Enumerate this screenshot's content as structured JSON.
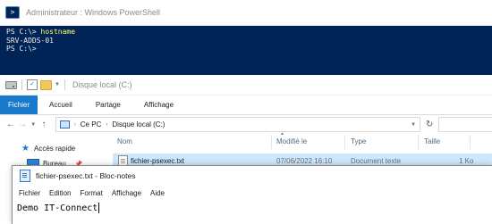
{
  "powershell": {
    "title": "Administrateur : Windows PowerShell",
    "lines": [
      {
        "prompt": "PS C:\\> ",
        "command": "hostname"
      },
      {
        "prompt": "SRV-ADDS-01",
        "command": ""
      },
      {
        "prompt": "PS C:\\>",
        "command": ""
      }
    ]
  },
  "explorer": {
    "title": "Disque local (C:)",
    "ribbon_tabs": [
      "Fichier",
      "Accueil",
      "Partage",
      "Affichage"
    ],
    "breadcrumb": [
      "Ce PC",
      "Disque local (C:)"
    ],
    "nav_pane": {
      "quick_access": "Accès rapide",
      "desktop": "Bureau"
    },
    "columns": {
      "name": "Nom",
      "modified": "Modifié le",
      "type": "Type",
      "size": "Taille"
    },
    "files": [
      {
        "name": "fichier-psexec.txt",
        "modified": "07/06/2022 16:10",
        "type": "Document texte",
        "size": "1 Ko"
      }
    ]
  },
  "notepad": {
    "title": "fichier-psexec.txt - Bloc-notes",
    "menu": [
      "Fichier",
      "Edition",
      "Format",
      "Affichage",
      "Aide"
    ],
    "content": "Demo IT-Connect"
  },
  "colors": {
    "ps_background": "#012456",
    "ps_command": "#ffff66",
    "ribbon_active": "#1979ca",
    "selection": "#cce8ff"
  }
}
